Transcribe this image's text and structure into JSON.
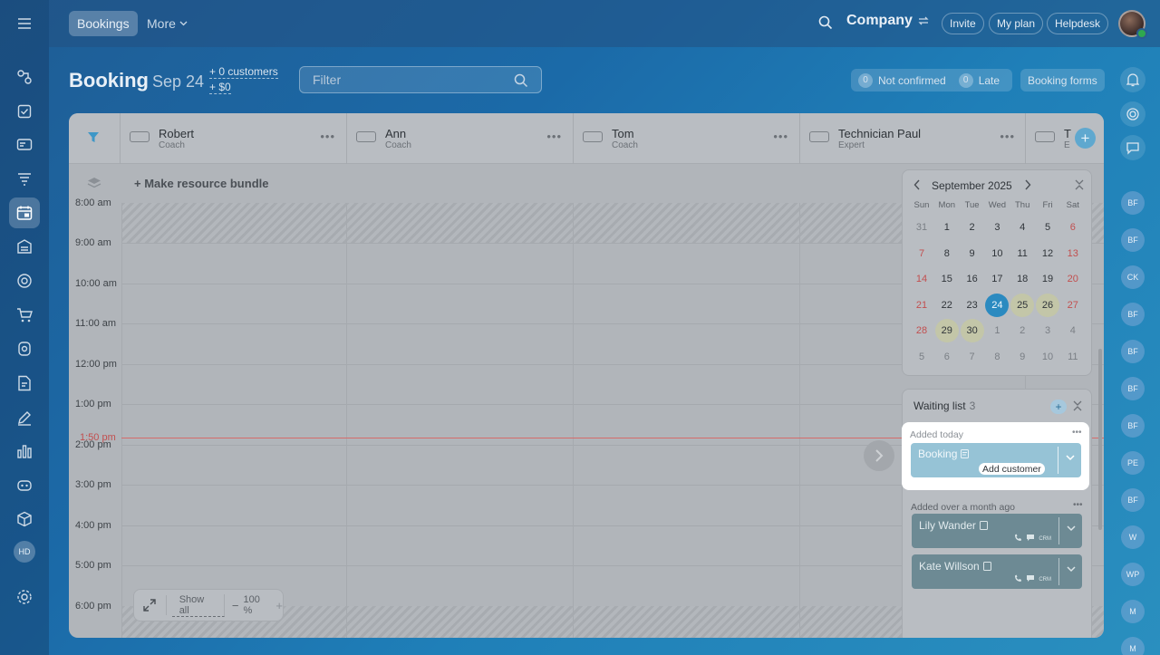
{
  "topbar": {
    "tab_bookings": "Bookings",
    "tab_more": "More",
    "company": "Company",
    "invite": "Invite",
    "my_plan": "My plan",
    "helpdesk": "Helpdesk"
  },
  "sidebar": {
    "hd_badge": "HD"
  },
  "header": {
    "title": "Booking",
    "date": "Sep 24",
    "customers": "+ 0 customers",
    "revenue": "+ $0",
    "filter_placeholder": "Filter",
    "not_confirmed_count": "0",
    "not_confirmed_label": "Not confirmed",
    "late_count": "0",
    "late_label": "Late",
    "booking_forms": "Booking forms"
  },
  "resources": [
    {
      "name": "Robert",
      "role": "Coach"
    },
    {
      "name": "Ann",
      "role": "Coach"
    },
    {
      "name": "Tom",
      "role": "Coach"
    },
    {
      "name": "Technician Paul",
      "role": "Expert"
    },
    {
      "name": "T",
      "role": "E"
    }
  ],
  "bundle_label": "+ Make resource bundle",
  "timeline": {
    "partial_label": "8:00 am",
    "hours": [
      "9:00 am",
      "10:00 am",
      "11:00 am",
      "12:00 pm",
      "1:00 pm",
      "2:00 pm",
      "3:00 pm",
      "4:00 pm",
      "5:00 pm",
      "6:00 pm"
    ],
    "now": "1:50 pm"
  },
  "zoom": {
    "show_all": "Show all",
    "minus": "−",
    "level": "100 %",
    "plus": "+"
  },
  "calendar": {
    "title": "September 2025",
    "dow": [
      "Sun",
      "Mon",
      "Tue",
      "Wed",
      "Thu",
      "Fri",
      "Sat"
    ],
    "weeks": [
      [
        "31",
        "1",
        "2",
        "3",
        "4",
        "5",
        "6"
      ],
      [
        "7",
        "8",
        "9",
        "10",
        "11",
        "12",
        "13"
      ],
      [
        "14",
        "15",
        "16",
        "17",
        "18",
        "19",
        "20"
      ],
      [
        "21",
        "22",
        "23",
        "24",
        "25",
        "26",
        "27"
      ],
      [
        "28",
        "29",
        "30",
        "1",
        "2",
        "3",
        "4"
      ],
      [
        "5",
        "6",
        "7",
        "8",
        "9",
        "10",
        "11"
      ]
    ],
    "selected": "24",
    "highlighted": [
      "25",
      "26",
      "29",
      "30"
    ]
  },
  "waiting": {
    "title": "Waiting list",
    "count": "3",
    "added_today": "Added today",
    "booking": "Booking",
    "add_customer": "Add customer",
    "added_old": "Added over a month ago",
    "entries": [
      {
        "name": "Lily Wander",
        "crm": "CRM"
      },
      {
        "name": "Kate Willson",
        "crm": "CRM"
      }
    ]
  },
  "right_rail": {
    "avatars": [
      "BF",
      "BF",
      "CK",
      "BF",
      "BF",
      "BF",
      "BF",
      "PE",
      "BF",
      "W",
      "WP",
      "M",
      "M"
    ]
  }
}
